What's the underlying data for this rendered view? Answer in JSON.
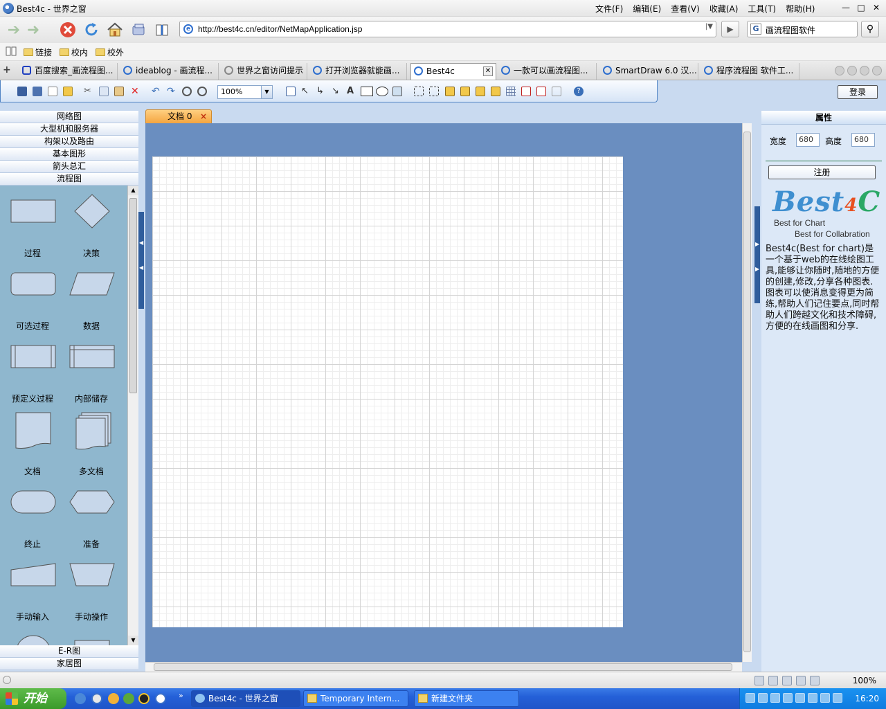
{
  "window": {
    "title": "Best4c - 世界之窗"
  },
  "menu": [
    "文件(F)",
    "编辑(E)",
    "查看(V)",
    "收藏(A)",
    "工具(T)",
    "帮助(H)"
  ],
  "address": {
    "url": "http://best4c.cn/editor/NetMapApplication.jsp"
  },
  "search": {
    "query": "画流程图软件"
  },
  "bookmarks": [
    "链接",
    "校内",
    "校外"
  ],
  "tabs": [
    {
      "label": "百度搜索_画流程图..."
    },
    {
      "label": "ideablog - 画流程..."
    },
    {
      "label": "世界之窗访问提示"
    },
    {
      "label": "打开浏览器就能画..."
    },
    {
      "label": "Best4c"
    },
    {
      "label": "一款可以画流程图..."
    },
    {
      "label": "SmartDraw 6.0 汉..."
    },
    {
      "label": "程序流程图 软件工..."
    }
  ],
  "toolbar": {
    "zoom": "100%",
    "login": "登录"
  },
  "categories_top": [
    "网络图",
    "大型机和服务器",
    "构架以及路由",
    "基本图形",
    "箭头总汇",
    "流程图"
  ],
  "categories_bottom": [
    "E-R图",
    "家居图"
  ],
  "shapes": [
    {
      "label": "过程",
      "icon": "process-shape-icon"
    },
    {
      "label": "决策",
      "icon": "decision-shape-icon"
    },
    {
      "label": "可选过程",
      "icon": "alternate-process-shape-icon"
    },
    {
      "label": "数据",
      "icon": "data-shape-icon"
    },
    {
      "label": "预定义过程",
      "icon": "predefined-process-shape-icon"
    },
    {
      "label": "内部储存",
      "icon": "internal-storage-shape-icon"
    },
    {
      "label": "文档",
      "icon": "document-shape-icon"
    },
    {
      "label": "多文档",
      "icon": "multi-document-shape-icon"
    },
    {
      "label": "终止",
      "icon": "terminator-shape-icon"
    },
    {
      "label": "准备",
      "icon": "preparation-shape-icon"
    },
    {
      "label": "手动输入",
      "icon": "manual-input-shape-icon"
    },
    {
      "label": "手动操作",
      "icon": "manual-operation-shape-icon"
    }
  ],
  "document": {
    "tab": "文档 0"
  },
  "properties": {
    "header": "属性",
    "width_label": "宽度",
    "width_value": "680",
    "height_label": "高度",
    "height_value": "680",
    "register": "注册"
  },
  "brand": {
    "logo_a": "Best",
    "logo_b": "4",
    "logo_c": "C",
    "slogan1": "Best for Chart",
    "slogan2": "Best for Collabration",
    "description": "Best4c(Best for chart)是一个基于web的在线绘图工具,能够让你随时,随地的方便的创建,修改,分享各种图表.图表可以使消息变得更为简练,帮助人们记住要点,同时帮助人们跨越文化和技术障碍,方便的在线画图和分享."
  },
  "statusbar": {
    "zoom": "100%"
  },
  "taskbar": {
    "start": "开始",
    "tasks": [
      "Best4c - 世界之窗",
      "Temporary Intern...",
      "新建文件夹"
    ],
    "clock": "16:20"
  }
}
